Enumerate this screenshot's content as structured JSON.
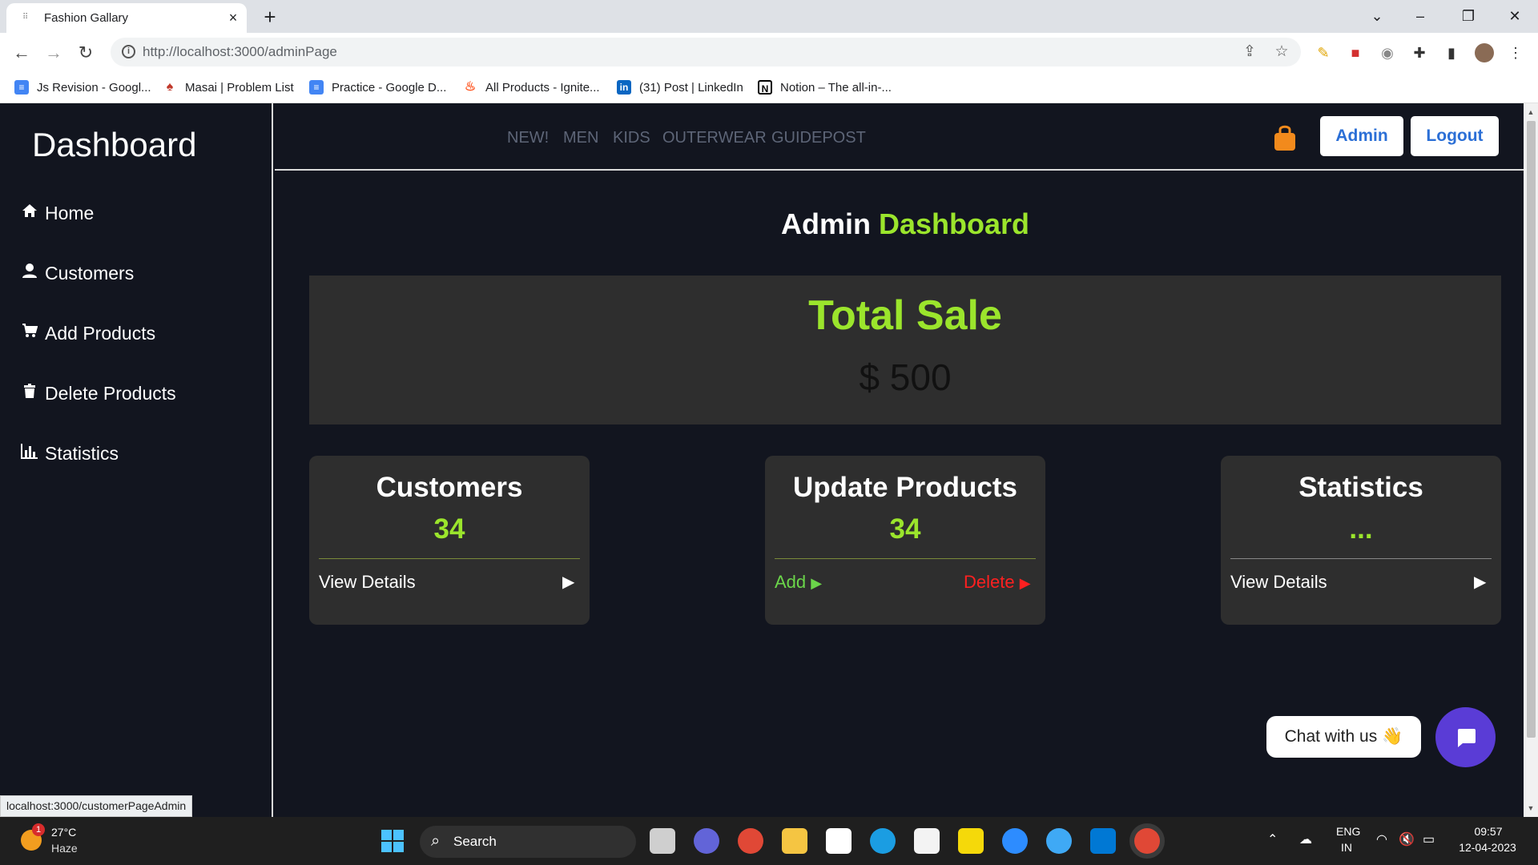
{
  "browser": {
    "tab_title": "Fashion Gallary",
    "close_glyph": "×",
    "new_tab_glyph": "+",
    "url": "http://localhost:3000/adminPage",
    "status_url": "localhost:3000/customerPageAdmin",
    "bookmarks": [
      {
        "label": "Js Revision - Googl...",
        "icon": "google-docs-icon",
        "color": "#4285f4"
      },
      {
        "label": "Masai | Problem List",
        "icon": "masai-icon",
        "color": "#c0392b"
      },
      {
        "label": "Practice - Google D...",
        "icon": "google-docs-icon",
        "color": "#4285f4"
      },
      {
        "label": "All Products - Ignite...",
        "icon": "flame-icon",
        "color": "#ff5722"
      },
      {
        "label": "(31) Post | LinkedIn",
        "icon": "linkedin-icon",
        "color": "#0a66c2"
      },
      {
        "label": "Notion – The all-in-...",
        "icon": "notion-icon",
        "color": "#000000"
      }
    ]
  },
  "sidebar": {
    "brand": "Dashboard",
    "items": [
      {
        "label": "Home",
        "icon": "home-icon"
      },
      {
        "label": "Customers",
        "icon": "user-icon"
      },
      {
        "label": "Add Products",
        "icon": "cart-icon"
      },
      {
        "label": "Delete Products",
        "icon": "trash-icon"
      },
      {
        "label": "Statistics",
        "icon": "bar-chart-icon"
      }
    ]
  },
  "topnav": {
    "links": [
      "NEW!",
      "MEN",
      "KIDS",
      "OUTERWEAR",
      "GUIDEPOST"
    ],
    "admin_label": "Admin",
    "logout_label": "Logout"
  },
  "main": {
    "heading_plain": "Admin",
    "heading_accent": "Dashboard",
    "total_sale_label": "Total Sale",
    "total_sale_value": "$ 500",
    "cards": [
      {
        "title": "Customers",
        "count": "34",
        "link": "View Details"
      },
      {
        "title": "Update Products",
        "count": "34",
        "add_label": "Add",
        "delete_label": "Delete"
      },
      {
        "title": "Statistics",
        "count": "...",
        "link": "View Details"
      }
    ]
  },
  "chat": {
    "label": "Chat with us",
    "emoji": "👋"
  },
  "taskbar": {
    "temperature": "27°C",
    "weather": "Haze",
    "weather_badge": "1",
    "search_label": "Search",
    "language": "ENG",
    "region": "IN",
    "time": "09:57",
    "date": "12-04-2023"
  },
  "colors": {
    "accent": "#9be52c",
    "link_blue": "#2b6fd6",
    "delete_red": "#ff2020",
    "chat_purple": "#5a3cd6",
    "page_bg": "#12151f"
  }
}
